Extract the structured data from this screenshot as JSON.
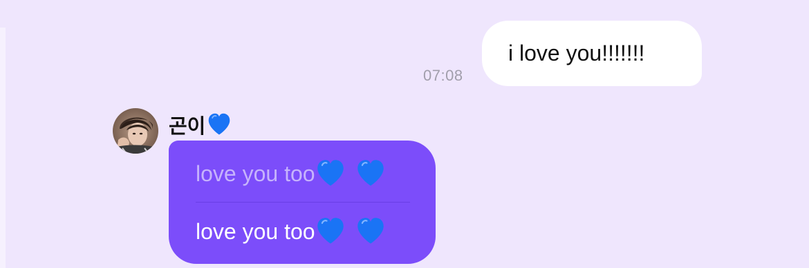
{
  "thread": {
    "sent_message": {
      "text": "i love you!!!!!!!",
      "time": "07:08"
    },
    "received_message": {
      "sender_name": "곤이",
      "sender_name_emoji": "blue-heart-icon",
      "quoted_text": "love you too",
      "reply_text": "love you too",
      "trailing_emojis": [
        "blue-heart-icon",
        "blue-heart-icon"
      ]
    }
  },
  "colors": {
    "background": "#efe6fd",
    "sent_bubble": "#ffffff",
    "received_bubble": "#7c4dfa",
    "quoted_text": "#c6b3fc",
    "heart": "#1a74f5"
  }
}
